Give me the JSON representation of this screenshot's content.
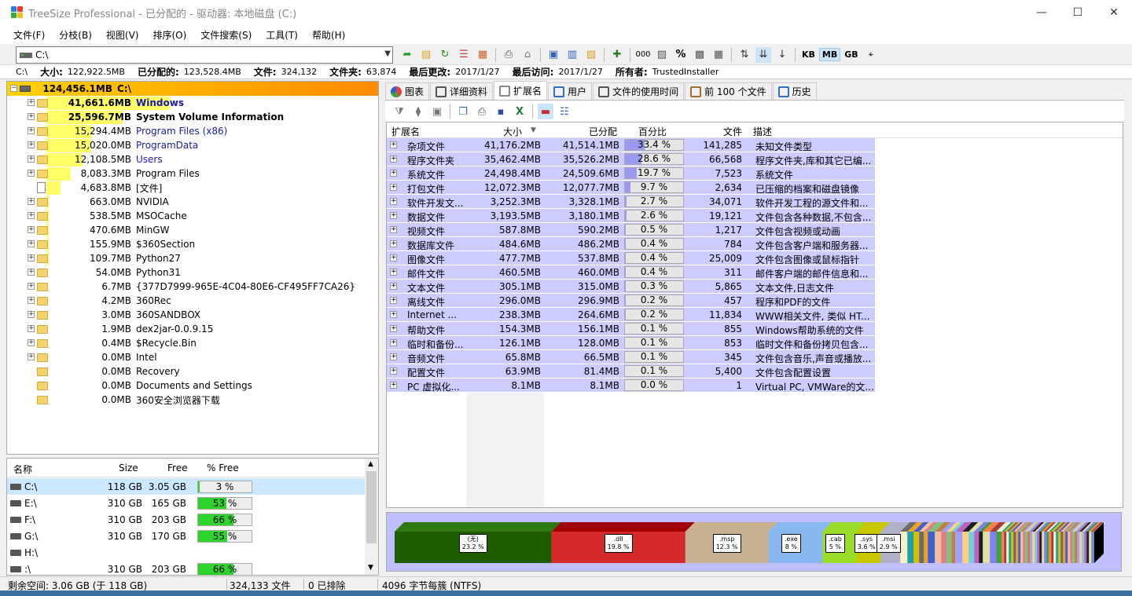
{
  "window": {
    "title": "TreeSize Professional - 已分配的 - 驱动器: 本地磁盘 (C:)"
  },
  "menu": [
    "文件(F)",
    "分枝(B)",
    "视图(V)",
    "排序(O)",
    "文件搜索(S)",
    "工具(T)",
    "帮助(H)"
  ],
  "toolbar": {
    "path": "C:\\",
    "units": [
      "KB",
      "MB",
      "GB"
    ],
    "active_unit": "MB"
  },
  "infobar": {
    "drive": "C:\\",
    "size_label": "大小:",
    "size": "122,922.5MB",
    "alloc_label": "已分配的:",
    "alloc": "123,528.4MB",
    "files_label": "文件:",
    "files": "324,132",
    "folders_label": "文件夹:",
    "folders": "63,874",
    "modified_label": "最后更改:",
    "modified": "2017/1/27",
    "accessed_label": "最后访问:",
    "accessed": "2017/1/27",
    "owner_label": "所有者:",
    "owner": "TrustedInstaller"
  },
  "tree": [
    {
      "size": "124,456.1MB",
      "name": "C:\\",
      "style": "root",
      "pct": 100
    },
    {
      "size": "41,661.6MB",
      "name": "Windows",
      "style": "bold-blue",
      "pct": 33.5
    },
    {
      "size": "25,596.7MB",
      "name": "System Volume Information",
      "style": "bold",
      "pct": 20.6
    },
    {
      "size": "15,294.4MB",
      "name": "Program Files (x86)",
      "style": "blue",
      "pct": 12.3
    },
    {
      "size": "15,020.0MB",
      "name": "ProgramData",
      "style": "blue",
      "pct": 12.1
    },
    {
      "size": "12,108.5MB",
      "name": "Users",
      "style": "blue",
      "pct": 9.7
    },
    {
      "size": "8,083.3MB",
      "name": "Program Files",
      "style": "",
      "pct": 6.5
    },
    {
      "size": "4,683.8MB",
      "name": "[文件]",
      "style": "file",
      "pct": 3.8
    },
    {
      "size": "663.0MB",
      "name": "NVIDIA",
      "style": "",
      "pct": 0.5
    },
    {
      "size": "538.5MB",
      "name": "MSOCache",
      "style": "",
      "pct": 0.4
    },
    {
      "size": "470.6MB",
      "name": "MinGW",
      "style": "",
      "pct": 0.4
    },
    {
      "size": "155.9MB",
      "name": "$360Section",
      "style": "",
      "pct": 0.1
    },
    {
      "size": "109.7MB",
      "name": "Python27",
      "style": "",
      "pct": 0.1
    },
    {
      "size": "54.0MB",
      "name": "Python31",
      "style": "",
      "pct": 0
    },
    {
      "size": "6.7MB",
      "name": "{377D7999-965E-4C04-80E6-CF495FF7CA26}",
      "style": "",
      "pct": 0
    },
    {
      "size": "4.2MB",
      "name": "360Rec",
      "style": "",
      "pct": 0
    },
    {
      "size": "3.0MB",
      "name": "360SANDBOX",
      "style": "",
      "pct": 0
    },
    {
      "size": "1.9MB",
      "name": "dex2jar-0.0.9.15",
      "style": "",
      "pct": 0
    },
    {
      "size": "0.4MB",
      "name": "$Recycle.Bin",
      "style": "",
      "pct": 0
    },
    {
      "size": "0.0MB",
      "name": "Intel",
      "style": "",
      "pct": 0
    },
    {
      "size": "0.0MB",
      "name": "Recovery",
      "style": "noplus",
      "pct": 0
    },
    {
      "size": "0.0MB",
      "name": "Documents and Settings",
      "style": "link",
      "pct": 0
    },
    {
      "size": "0.0MB",
      "name": "360安全浏览器下载",
      "style": "noplus",
      "pct": 0
    }
  ],
  "drives": {
    "headers": [
      "名称",
      "Size",
      "Free",
      "% Free"
    ],
    "rows": [
      {
        "name": "C:\\",
        "size": "118 GB",
        "free": "3.05 GB",
        "pfree": "3 %",
        "pct": 3
      },
      {
        "name": "E:\\",
        "size": "310 GB",
        "free": "165 GB",
        "pfree": "53 %",
        "pct": 53
      },
      {
        "name": "F:\\",
        "size": "310 GB",
        "free": "203 GB",
        "pfree": "66 %",
        "pct": 66
      },
      {
        "name": "G:\\",
        "size": "310 GB",
        "free": "170 GB",
        "pfree": "55 %",
        "pct": 55
      },
      {
        "name": "H:\\",
        "size": "",
        "free": "",
        "pfree": "",
        "pct": -1
      },
      {
        "name": ":\\",
        "size": "310 GB",
        "free": "203 GB",
        "pfree": "66 %",
        "pct": 66
      }
    ]
  },
  "tabs": [
    "图表",
    "详细资料",
    "扩展名",
    "用户",
    "文件的使用时间",
    "前 100 个文件",
    "历史"
  ],
  "active_tab": 2,
  "ext_table": {
    "headers": [
      "扩展名",
      "大小",
      "已分配",
      "百分比",
      "文件",
      "描述"
    ],
    "rows": [
      [
        "杂项文件",
        "41,176.2MB",
        "41,514.1MB",
        "33.4 %",
        "141,285",
        "未知文件类型",
        33.4
      ],
      [
        "程序文件夹",
        "35,462.4MB",
        "35,526.2MB",
        "28.6 %",
        "66,568",
        "程序文件夹,库和其它已编...",
        28.6
      ],
      [
        "系统文件",
        "24,498.4MB",
        "24,509.6MB",
        "19.7 %",
        "7,523",
        "系统文件",
        19.7
      ],
      [
        "打包文件",
        "12,072.3MB",
        "12,077.7MB",
        "9.7 %",
        "2,634",
        "已压缩的档案和磁盘镜像",
        9.7
      ],
      [
        "软件开发文...",
        "3,252.3MB",
        "3,328.1MB",
        "2.7 %",
        "34,071",
        "软件开发工程的源文件和...",
        2.7
      ],
      [
        "数据文件",
        "3,193.5MB",
        "3,180.1MB",
        "2.6 %",
        "19,121",
        "文件包含各种数据,不包含...",
        2.6
      ],
      [
        "视频文件",
        "587.8MB",
        "590.2MB",
        "0.5 %",
        "1,217",
        "文件包含视频或动画",
        0.5
      ],
      [
        "数据库文件",
        "484.6MB",
        "486.2MB",
        "0.4 %",
        "784",
        "文件包含客户端和服务器...",
        0.4
      ],
      [
        "图像文件",
        "477.7MB",
        "537.8MB",
        "0.4 %",
        "25,009",
        "文件包含图像或鼠标指针",
        0.4
      ],
      [
        "邮件文件",
        "460.5MB",
        "460.0MB",
        "0.4 %",
        "311",
        "邮件客户端的邮件信息和...",
        0.4
      ],
      [
        "文本文件",
        "305.1MB",
        "315.0MB",
        "0.3 %",
        "5,865",
        "文本文件,日志文件",
        0.3
      ],
      [
        "离线文件",
        "296.0MB",
        "296.9MB",
        "0.2 %",
        "457",
        "程序和PDF的文件",
        0.2
      ],
      [
        "Internet ...",
        "238.3MB",
        "264.6MB",
        "0.2 %",
        "11,834",
        "WWW相关文件, 类似 HT...",
        0.2
      ],
      [
        "帮助文件",
        "154.3MB",
        "156.1MB",
        "0.1 %",
        "855",
        "Windows帮助系统的文件",
        0.1
      ],
      [
        "临时和备份...",
        "126.1MB",
        "128.0MB",
        "0.1 %",
        "853",
        "临时文件和备份拷贝包含...",
        0.1
      ],
      [
        "音频文件",
        "65.8MB",
        "66.5MB",
        "0.1 %",
        "345",
        "文件包含音乐,声音或播放...",
        0.1
      ],
      [
        "配置文件",
        "63.9MB",
        "81.4MB",
        "0.1 %",
        "5,400",
        "文件包含配置设置",
        0.1
      ],
      [
        "PC 虚拟化...",
        "8.1MB",
        "8.1MB",
        "0.0 %",
        "1",
        "Virtual PC, VMWare的文...",
        0
      ]
    ]
  },
  "ext_band": [
    {
      "ext": "(无)",
      "pct": "23.2 %",
      "value": 23.2,
      "color": "#1e5c00"
    },
    {
      "ext": ".dll",
      "pct": "19.8 %",
      "value": 19.8,
      "color": "#d42a2a"
    },
    {
      "ext": ".msp",
      "pct": "12.3 %",
      "value": 12.3,
      "color": "#c8b090"
    },
    {
      "ext": ".exe",
      "pct": "8 %",
      "value": 8,
      "color": "#88b8f0"
    },
    {
      "ext": ".cab",
      "pct": "5 %",
      "value": 5,
      "color": "#9adc28"
    },
    {
      "ext": ".sys",
      "pct": "3.6 %",
      "value": 3.6,
      "color": "#c8c800"
    },
    {
      "ext": ".msi",
      "pct": "2.9 %",
      "value": 2.9,
      "color": "#b0b0c8"
    }
  ],
  "status": {
    "free_space": "剩余空间: 3.06 GB (于 118 GB)",
    "files": "324,133  文件",
    "excluded": "0 已排除",
    "cluster": "4096 字节每簇 (NTFS)"
  }
}
